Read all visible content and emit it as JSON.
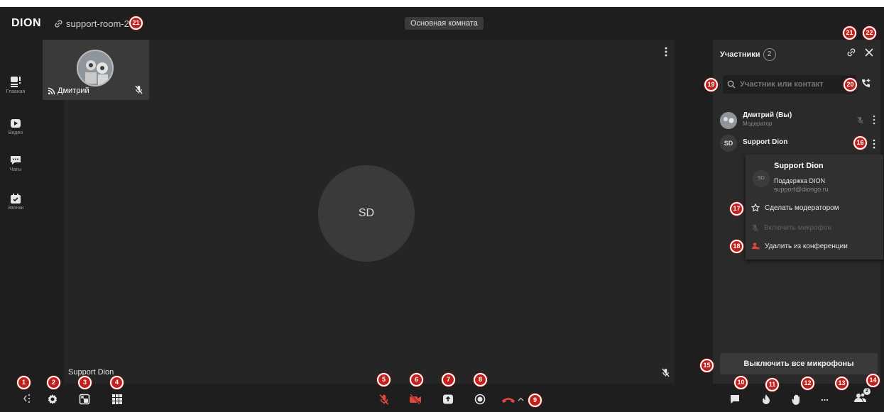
{
  "app": {
    "logo": "DION",
    "room_link": "support-room-2",
    "room_title": "Основная комната"
  },
  "left_nav": {
    "items": [
      {
        "label": "Главная",
        "icon": "home-icon"
      },
      {
        "label": "Видео",
        "icon": "video-icon"
      },
      {
        "label": "Чаты",
        "icon": "chat-icon"
      },
      {
        "label": "Звонки",
        "icon": "calls-icon"
      }
    ]
  },
  "stage": {
    "self_tile_name": "Дмитрий",
    "speaker_initials": "SD",
    "speaker_name": "Support Dion"
  },
  "panel": {
    "title": "Участники",
    "count": "2",
    "search_placeholder": "Участник или контакт",
    "participants": [
      {
        "name": "Дмитрий (Вы)",
        "role": "Модератор"
      },
      {
        "initials": "SD",
        "name": "Support Dion"
      }
    ],
    "mute_all_label": "Выключить все микрофоны"
  },
  "context_menu": {
    "avatar_initials": "SD",
    "name": "Support Dion",
    "org": "Поддержка DION",
    "email": "support@diongo.ru",
    "items": [
      {
        "label": "Сделать модератором",
        "icon": "star-icon",
        "enabled": true
      },
      {
        "label": "Включить микрофон",
        "icon": "mic-icon",
        "enabled": false
      },
      {
        "label": "Удалить из конференции",
        "icon": "remove-user-icon",
        "enabled": true
      }
    ]
  },
  "bottombar": {
    "more_label": "...",
    "participants_badge": "2"
  },
  "callouts": [
    "21",
    "21",
    "22",
    "19",
    "20",
    "16",
    "17",
    "18",
    "15",
    "1",
    "2",
    "3",
    "4",
    "5",
    "6",
    "7",
    "8",
    "9",
    "10",
    "11",
    "12",
    "13",
    "14"
  ],
  "colors": {
    "background": "#1e1e1e",
    "panel": "#2a2a2a",
    "accent_red": "#e0483e",
    "callout": "#c0211c"
  }
}
